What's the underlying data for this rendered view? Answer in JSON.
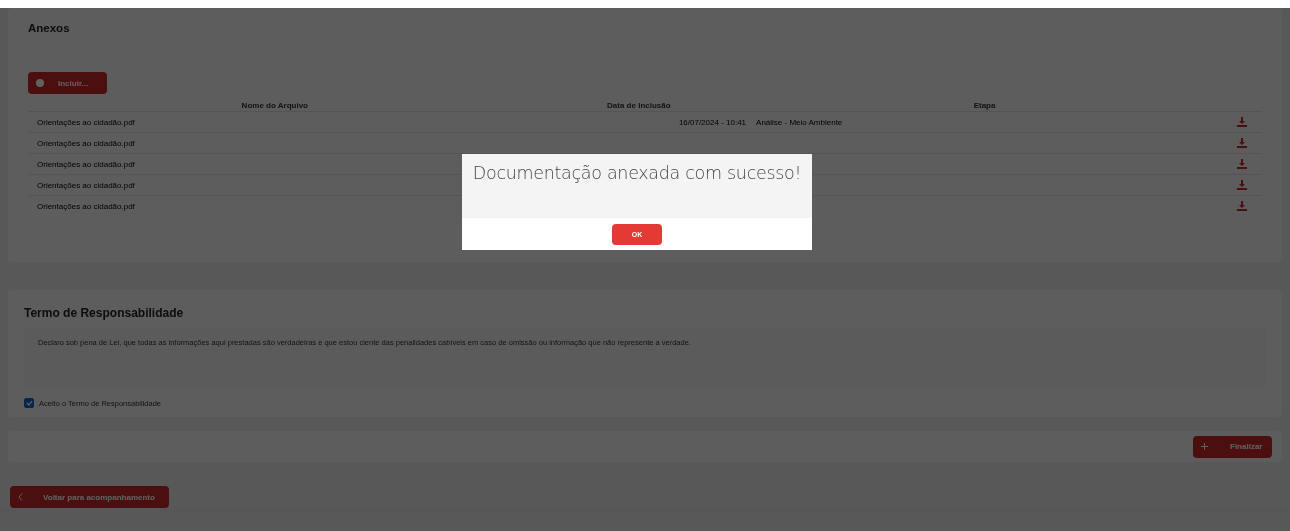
{
  "attachments": {
    "title": "Anexos",
    "add_button": "Incluir...",
    "columns": [
      "Nome do Arquivo",
      "Data de Inclusão",
      "Etapa"
    ],
    "rows": [
      {
        "name": "Orientações ao cidadão.pdf",
        "date": "16/07/2024 - 10:41",
        "stage": "Análise - Meio Ambiente"
      },
      {
        "name": "Orientações ao cidadão.pdf"
      },
      {
        "name": "Orientações ao cidadão.pdf"
      },
      {
        "name": "Orientações ao cidadão.pdf"
      },
      {
        "name": "Orientações ao cidadão.pdf"
      }
    ]
  },
  "terms": {
    "title": "Termo de Responsabilidade",
    "text": "Declaro sob pena de Lei, que todas as informações aqui prestadas são verdadeiras e que estou ciente das penalidades cabíveis em caso de omissão ou informação que não represente a verdade.",
    "accept": {
      "label": "Aceito o Termo de Responsabilidade",
      "checked": true
    }
  },
  "finish_button": "Finalizar",
  "back_button": "Voltar para acompanhamento",
  "dialog": {
    "message": "Documentação anexada com sucesso!",
    "button": "OK"
  }
}
